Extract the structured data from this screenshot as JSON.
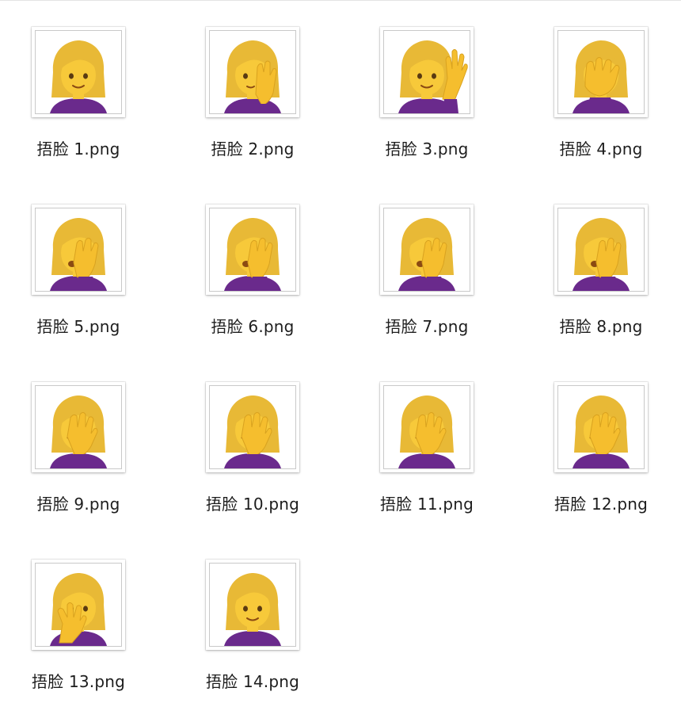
{
  "files": [
    {
      "name": "捂脸 1.png",
      "pose": "neutral-smile"
    },
    {
      "name": "捂脸 2.png",
      "pose": "hand-right-cheek"
    },
    {
      "name": "捂脸 3.png",
      "pose": "raised-hand-wave"
    },
    {
      "name": "捂脸 4.png",
      "pose": "hand-over-eyes"
    },
    {
      "name": "捂脸 5.png",
      "pose": "facepalm"
    },
    {
      "name": "捂脸 6.png",
      "pose": "facepalm"
    },
    {
      "name": "捂脸 7.png",
      "pose": "facepalm"
    },
    {
      "name": "捂脸 8.png",
      "pose": "facepalm"
    },
    {
      "name": "捂脸 9.png",
      "pose": "facepalm-center"
    },
    {
      "name": "捂脸 10.png",
      "pose": "facepalm-center"
    },
    {
      "name": "捂脸 11.png",
      "pose": "facepalm-center"
    },
    {
      "name": "捂脸 12.png",
      "pose": "facepalm-center"
    },
    {
      "name": "捂脸 13.png",
      "pose": "hand-under-chin"
    },
    {
      "name": "捂脸 14.png",
      "pose": "neutral-smile"
    }
  ],
  "colors": {
    "hair": "#E8B936",
    "skin": "#F7C93A",
    "hand": "#F5BE2E",
    "shirt": "#6A2A8C",
    "thumb_border": "#C9C9C9"
  }
}
